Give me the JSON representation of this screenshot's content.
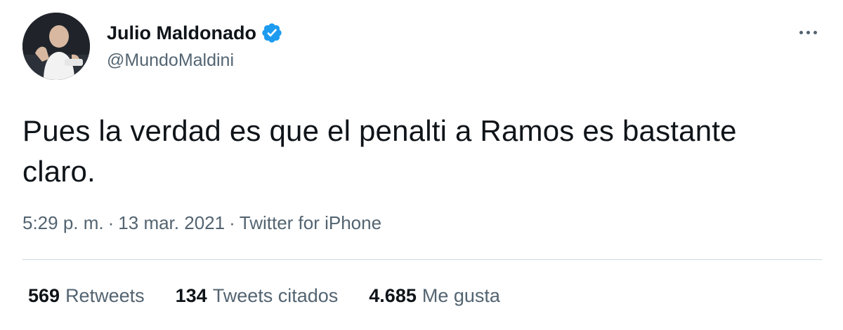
{
  "author": {
    "display_name": "Julio Maldonado",
    "handle": "@MundoMaldini",
    "verified_icon": "verified-badge-icon",
    "avatar_icon": "profile-avatar"
  },
  "tweet": {
    "text": "Pues la verdad es que el penalti a Ramos es bastante claro.",
    "time": "5:29 p. m.",
    "separator": "·",
    "date": "13 mar. 2021",
    "source": "Twitter for iPhone"
  },
  "stats": {
    "retweets": {
      "count": "569",
      "label": "Retweets"
    },
    "quotes": {
      "count": "134",
      "label": "Tweets citados"
    },
    "likes": {
      "count": "4.685",
      "label": "Me gusta"
    }
  },
  "colors": {
    "text_primary": "#0f1419",
    "text_secondary": "#536471",
    "verified_blue": "#1d9bf0",
    "divider": "#cfd9de"
  },
  "icons": {
    "more": "more-options-icon"
  }
}
